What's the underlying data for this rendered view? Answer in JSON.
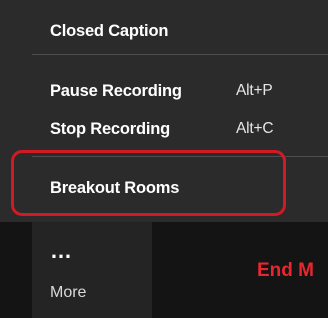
{
  "menu": {
    "closed_caption": "Closed Caption",
    "pause_recording": {
      "label": "Pause Recording",
      "shortcut": "Alt+P"
    },
    "stop_recording": {
      "label": "Stop Recording",
      "shortcut": "Alt+C"
    },
    "breakout_rooms": "Breakout Rooms"
  },
  "toolbar": {
    "more_icon": "…",
    "more_label": "More",
    "end_meeting": "End M"
  },
  "colors": {
    "menu_bg": "#2b2b2c",
    "highlight": "#d11a24",
    "end_meeting": "#e8262f"
  }
}
